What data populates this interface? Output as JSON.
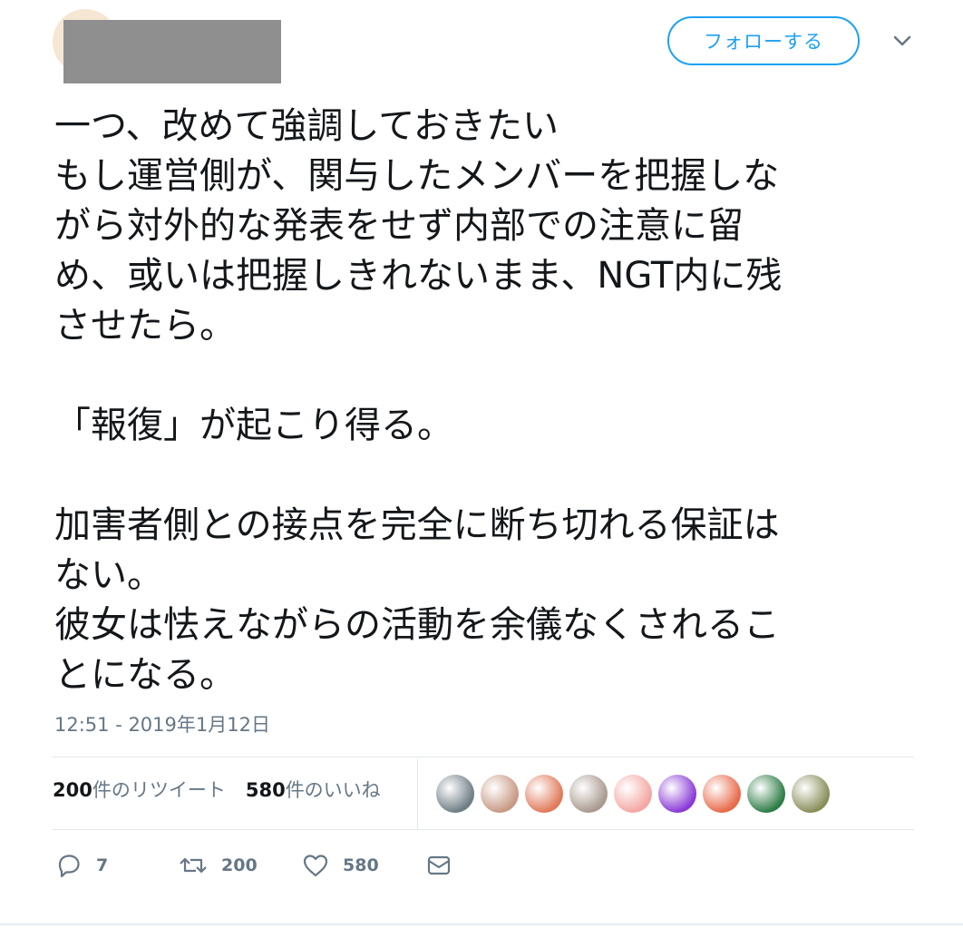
{
  "header": {
    "follow_label": "フォローする",
    "accent_color": "#1da1f2"
  },
  "tweet": {
    "text": "一つ、改めて強調しておきたい\nもし運営側が、関与したメンバーを把握しな\nがら対外的な発表をせず内部での注意に留\nめ、或いは把握しきれないまま、NGT内に残\nさせたら。\n\n「報復」が起こり得る。\n\n加害者側との接点を完全に断ち切れる保証は\nない。\n彼女は怯えながらの活動を余儀なくされるこ\nとになる。",
    "timestamp": "12:51 - 2019年1月12日"
  },
  "stats": {
    "retweets_count": "200",
    "retweets_label": "件のリツイート",
    "likes_count": "580",
    "likes_label": "件のいいね"
  },
  "likers": [
    {
      "icon": "liker-avatar",
      "color": "#6f7e86"
    },
    {
      "icon": "liker-avatar",
      "color": "#c79a85"
    },
    {
      "icon": "liker-avatar",
      "color": "#e07a5a"
    },
    {
      "icon": "liker-avatar",
      "color": "#a99a8f"
    },
    {
      "icon": "liker-avatar",
      "color": "#f4a7a3"
    },
    {
      "icon": "liker-avatar",
      "color": "#8a3bd6"
    },
    {
      "icon": "liker-avatar",
      "color": "#e86a4a"
    },
    {
      "icon": "liker-avatar",
      "color": "#2e7d46"
    },
    {
      "icon": "liker-avatar",
      "color": "#8a8f5a"
    }
  ],
  "actions": {
    "reply_icon": "reply-icon",
    "reply_count": "7",
    "retweet_icon": "retweet-icon",
    "retweet_count": "200",
    "like_icon": "heart-icon",
    "like_count": "580",
    "dm_icon": "envelope-icon"
  }
}
